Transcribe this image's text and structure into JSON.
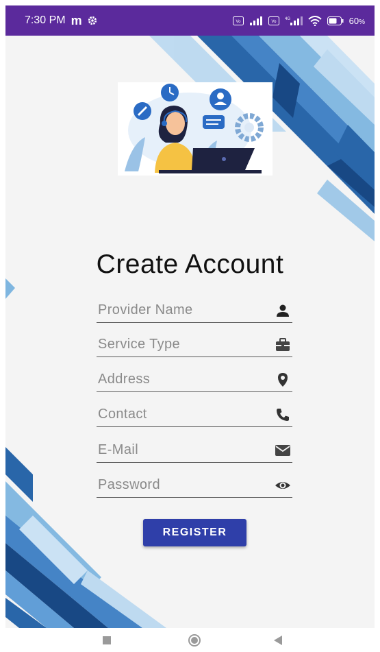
{
  "status_bar": {
    "time": "7:30 PM",
    "carrier_glyph": "m",
    "battery": "60",
    "battery_unit": "%",
    "icons": [
      "settings-gear-icon",
      "volte-icon",
      "signal-icon",
      "volte-icon",
      "4g-signal-icon",
      "wifi-icon",
      "battery-icon"
    ]
  },
  "form": {
    "title": "Create Account",
    "fields": [
      {
        "placeholder": "Provider Name",
        "icon": "person-icon"
      },
      {
        "placeholder": "Service Type",
        "icon": "briefcase-icon"
      },
      {
        "placeholder": "Address",
        "icon": "location-pin-icon"
      },
      {
        "placeholder": "Contact",
        "icon": "phone-icon"
      },
      {
        "placeholder": "E-Mail",
        "icon": "mail-icon"
      },
      {
        "placeholder": "Password",
        "icon": "eye-icon"
      }
    ],
    "register_label": "REGISTER"
  },
  "nav_bar": {
    "buttons": [
      "recents-square-icon",
      "home-circle-icon",
      "back-triangle-icon"
    ]
  },
  "colors": {
    "status_bar": "#5b2a9c",
    "register_button": "#2f3fa9",
    "deco_dark": "#1f5fa6",
    "deco_light": "#7fb6e0"
  }
}
